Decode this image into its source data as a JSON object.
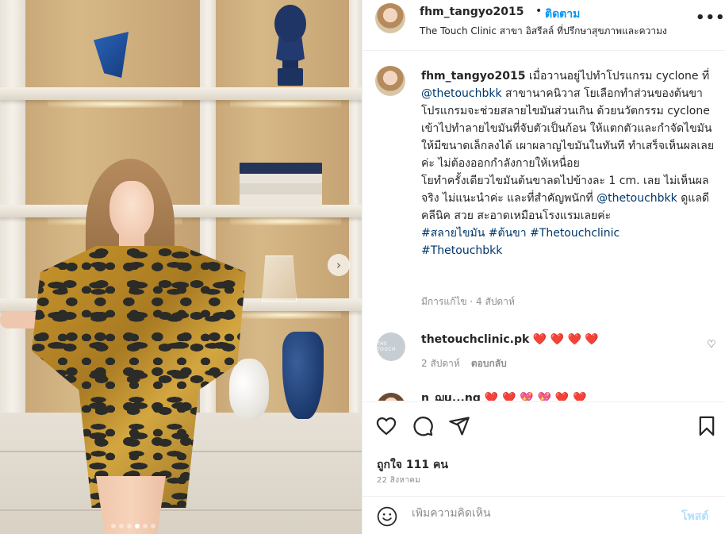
{
  "header": {
    "username": "fhm_tangyo2015",
    "separator": "•",
    "follow_label": "ติดตาม",
    "location": "The Touch Clinic สาขา อิสรีลล์ ที่ปรึกษาสุขภาพและความง",
    "more_label": "•••"
  },
  "caption": {
    "username": "fhm_tangyo2015",
    "part1": " เมื่อวานอยู่ไปทำโปรแกรม cyclone ที่ ",
    "mention1": "@thetouchbkk",
    "part2": " สาขานาคนิวาส โยเลือกทำส่วนของต้นขา โปรแกรมจะช่วยสลายไขมันส่วนเกิน ด้วยนวัตกรรม cyclone เข้าไปทำลายไขมันที่จับตัวเป็นก้อน ให้แตกตัวและกำจัดไขมันให้มีขนาดเล็กลงได้ เผาผลาญไขมันในทันที ทำเสร็จเห็นผลเลยค่ะ ไม่ต้องออกกำลังกายให้เหนื่อย",
    "part3": "โยทำครั้งเดียวไขมันต้นขาลดไปข้างละ 1 cm. เลย ไม่เห็นผลจริง ไม่แนะนำค่ะ และที่สำคัญพนักที่ ",
    "mention2": "@thetouchbkk",
    "part4": " ดูแลดี คลีนิค สวย สะอาดเหมือนโรงแรมเลยค่ะ",
    "tags_line1": "#สลายไขมัน #ต้นขา #Thetouchclinic",
    "tags_line2": "#Thetouchbkk",
    "meta": "มีการแก้ไข · 4 สัปดาห์"
  },
  "comment1": {
    "avatar_text": "THE TOUCH",
    "username": "thetouchclinic.pk",
    "hearts": "❤️ ❤️ ❤️ ❤️",
    "time": "2 สัปดาห์",
    "reply_label": "ตอบกลับ",
    "like_icon": "♡"
  },
  "comment2": {
    "partial_text": "n_ฌu...ng ❤️ ❤️ 💖 💖 ❤️ ❤️"
  },
  "actions": {
    "likes_label": "ถูกใจ 111 คน",
    "date_label": "22 สิงหาคม"
  },
  "add_comment": {
    "placeholder": "เพิ่มความคิดเห็น",
    "post_label": "โพสต์"
  },
  "media": {
    "next_label": "›",
    "slides": 6,
    "active_slide": 4
  },
  "colors": {
    "link_blue": "#0095f6",
    "mention_blue": "#00376b",
    "muted_gray": "#8e8e8e",
    "post_disabled": "#b2dffc",
    "heart_red": "#ed4956"
  }
}
